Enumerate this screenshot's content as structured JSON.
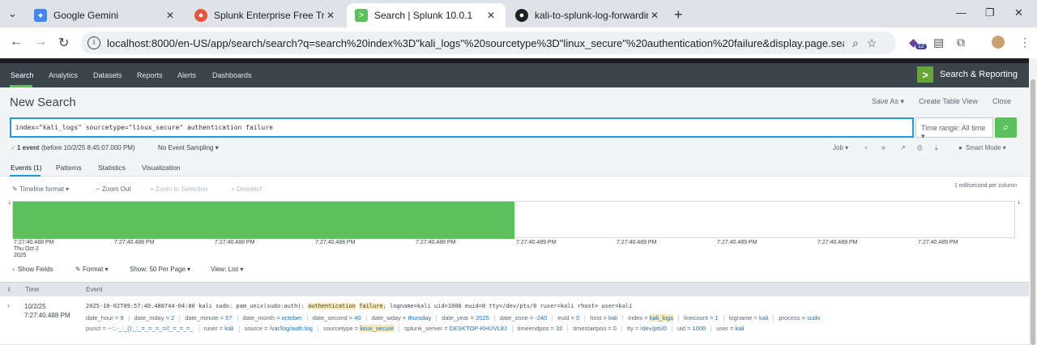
{
  "browser": {
    "tabs": [
      {
        "title": "Google Gemini",
        "favicon_color": "#4285f4",
        "icon": "gemini-icon"
      },
      {
        "title": "Splunk Enterprise Free Trial | Sp",
        "favicon_color": "#e8543a",
        "icon": "splunk-icon"
      },
      {
        "title": "Search | Splunk 10.0.1",
        "favicon_color": "#5cc05c",
        "icon": "splunk-app-icon"
      },
      {
        "title": "kali-to-splunk-log-forwarding/",
        "favicon_color": "#1f1f1f",
        "icon": "github-icon"
      }
    ],
    "url": "localhost:8000/en-US/app/search/search?q=search%20index%3D\"kali_logs\"%20sourcetype%3D\"linux_secure\"%20authentication%20failure&display.page.search.mode=smart&...",
    "ext_badge": "12"
  },
  "nav": {
    "items": [
      "Search",
      "Analytics",
      "Datasets",
      "Reports",
      "Alerts",
      "Dashboards"
    ],
    "app_title": "Search & Reporting"
  },
  "search": {
    "title": "New Search",
    "save_as": "Save As ▾",
    "create_table_view": "Create Table View",
    "close": "Close",
    "query": "index=\"kali_logs\" sourcetype=\"linux_secure\" authentication failure",
    "time_range": "Time range: All time ▾"
  },
  "status": {
    "events": "1 event",
    "before": "(before 10/2/25 8:45:07.000 PM)",
    "sampling": "No Event Sampling ▾",
    "job": "Job ▾",
    "mode": "Smart Mode ▾"
  },
  "result_tabs": [
    "Events (1)",
    "Patterns",
    "Statistics",
    "Visualization"
  ],
  "timeline": {
    "format": "Timeline format ▾",
    "zoom_out": "Zoom Out",
    "zoom_selection": "+ Zoom to Selection",
    "deselect": "× Deselect",
    "scale": "1 millisecond per column",
    "ymax": "1",
    "fill_fraction": 0.5,
    "ticks": [
      "7:27:40.488 PM",
      "7:27:40.488 PM",
      "7:27:40.488 PM",
      "7:27:40.488 PM",
      "7:27:40.488 PM",
      "7:27:40.489 PM",
      "7:27:40.489 PM",
      "7:27:40.489 PM",
      "7:27:40.489 PM",
      "7:27:40.489 PM"
    ],
    "first_tick_extra": [
      "Thu Oct 2",
      "2025"
    ]
  },
  "controls": {
    "show_fields": "Show Fields",
    "format": "Format ▾",
    "per_page": "Show: 50 Per Page ▾",
    "view": "View: List ▾"
  },
  "table": {
    "headers": [
      "i",
      "Time",
      "Event"
    ],
    "row": {
      "date": "10/2/25",
      "time": "7:27:40.488 PM",
      "raw_pre": "2025-10-02T09:57:40.488744-04:00 kali sudo: pam_unix(sudo:auth): ",
      "raw_hl1": "authentication",
      "raw_hl2": "failure",
      "raw_post": "; logname=kali uid=1000 euid=0 tty=/dev/pts/0 ruser=kali rhost=  user=kali",
      "fields_line1": [
        [
          "date_hour",
          "9"
        ],
        [
          "date_mday",
          "2"
        ],
        [
          "date_minute",
          "57"
        ],
        [
          "date_month",
          "october"
        ],
        [
          "date_second",
          "40"
        ],
        [
          "date_wday",
          "thursday"
        ],
        [
          "date_year",
          "2025"
        ],
        [
          "date_zone",
          "-240"
        ],
        [
          "euid",
          "0"
        ],
        [
          "host",
          "kali"
        ],
        [
          "index",
          "kali_logs"
        ],
        [
          "linecount",
          "1"
        ],
        [
          "logname",
          "kali"
        ],
        [
          "process",
          "sudo"
        ]
      ],
      "fields_line2": [
        [
          "punct",
          "--::.-_:_():_;_=_=_=_=//_=_=_=_"
        ],
        [
          "ruser",
          "kali"
        ],
        [
          "source",
          "/var/log/auth.log"
        ],
        [
          "sourcetype",
          "linux_secure"
        ],
        [
          "splunk_server",
          "DESKTOP-KHUVL8J"
        ],
        [
          "timeendpos",
          "32"
        ],
        [
          "timestartpos",
          "0"
        ],
        [
          "tty",
          "/dev/pts/0"
        ],
        [
          "uid",
          "1000"
        ],
        [
          "user",
          "kali"
        ]
      ]
    }
  }
}
